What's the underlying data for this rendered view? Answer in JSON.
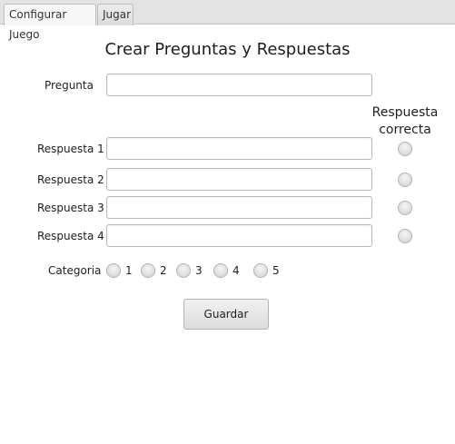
{
  "tabs": [
    {
      "label": "Configurar Juego",
      "active": true
    },
    {
      "label": "Jugar",
      "active": false
    }
  ],
  "form": {
    "title": "Crear Preguntas y Respuestas",
    "question_label": "Pregunta",
    "question_value": "",
    "correct_header_line1": "Respuesta",
    "correct_header_line2": "correcta",
    "answers": [
      {
        "label": "Respuesta 1",
        "value": "",
        "correct": false
      },
      {
        "label": "Respuesta 2",
        "value": "",
        "correct": false
      },
      {
        "label": "Respuesta 3",
        "value": "",
        "correct": false
      },
      {
        "label": "Respuesta 4",
        "value": "",
        "correct": false
      }
    ],
    "category_label": "Categoria",
    "categories": [
      "1",
      "2",
      "3",
      "4",
      "5"
    ],
    "save_label": "Guardar"
  }
}
